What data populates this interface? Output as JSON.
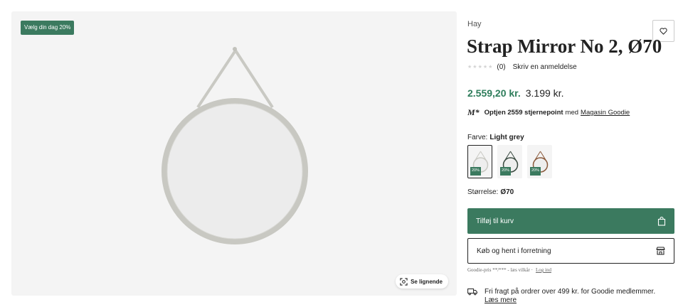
{
  "gallery": {
    "badge": "Vælg din dag 20%",
    "similar_label": "Se lignende"
  },
  "product": {
    "brand": "Hay",
    "title": "Strap Mirror No 2, Ø70",
    "rating_count": "(0)",
    "write_review": "Skriv en anmeldelse",
    "sale_price": "2.559,20 kr.",
    "original_price": "3.199 kr."
  },
  "points": {
    "logo": "M*",
    "bold_text": "Optjen 2559 stjernepoint",
    "middle_text": "med",
    "link": "Magasin Goodie"
  },
  "options": {
    "colour_label": "Farve:",
    "colour_value": "Light grey",
    "swatch_tag": "20%",
    "size_label": "Størrelse:",
    "size_value": "Ø70"
  },
  "actions": {
    "add_to_cart": "Tilføj til kurv",
    "buy_in_store": "Køb og hent i forretning"
  },
  "terms": {
    "text": "Goodie-pris **/*** - læs vilkår ·",
    "login": "Log ind"
  },
  "shipping": {
    "text": "Fri fragt på ordrer over 499 kr. for Goodie medlemmer.",
    "more": "Læs mere"
  },
  "colors": {
    "accent": "#3b7a5f",
    "price_green": "#2e7d5b",
    "gallery_bg": "#f4f4f4"
  }
}
